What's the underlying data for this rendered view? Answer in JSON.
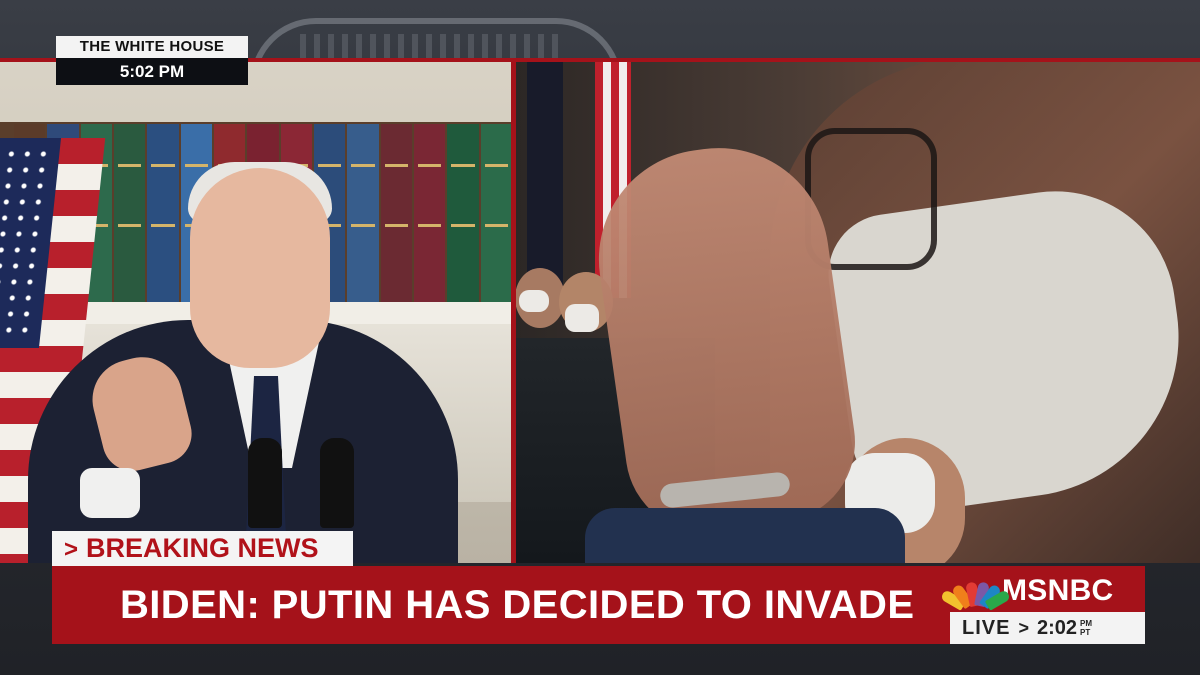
{
  "location": {
    "title": "THE WHITE HOUSE",
    "time": "5:02 PM"
  },
  "lower_third": {
    "breaking_label": "BREAKING NEWS",
    "breaking_chevron": ">",
    "headline": "BIDEN: PUTIN HAS DECIDED TO INVADE"
  },
  "network": {
    "logo_text": "MSNBC",
    "live_label": "LIVE",
    "live_chevron": ">",
    "time": "2:02",
    "ampm_top": "PM",
    "ampm_bottom": "PT"
  },
  "colors": {
    "accent_red": "#a5121a",
    "peacock": [
      "#f2c12e",
      "#f07f1b",
      "#e23b34",
      "#7b58a6",
      "#1d86c6",
      "#2aa84a"
    ]
  },
  "icons": [
    "nbc-peacock-icon"
  ]
}
